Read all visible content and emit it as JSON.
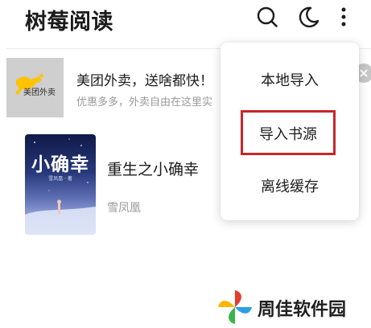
{
  "header": {
    "app_title": "树莓阅读",
    "icons": [
      "search-icon",
      "night-mode-icon",
      "more-vert-icon"
    ]
  },
  "ad": {
    "thumb_brand": "美团外卖",
    "title": "美团外卖，送啥都快！",
    "description": "优惠多多，外卖自由在这里实",
    "close_icon": "close-icon",
    "thumb_color": "#cfcfcf",
    "brand_color": "#ffc300"
  },
  "book": {
    "cover_title": "小确幸",
    "cover_author": "雪凤凰 · 著",
    "title": "重生之小确幸",
    "author": "雪凤凰"
  },
  "menu": {
    "items": [
      {
        "label": "本地导入"
      },
      {
        "label": "导入书源"
      },
      {
        "label": "离线缓存"
      }
    ],
    "highlight_color": "#c8262a"
  },
  "watermark": {
    "text": "周佳软件园"
  }
}
